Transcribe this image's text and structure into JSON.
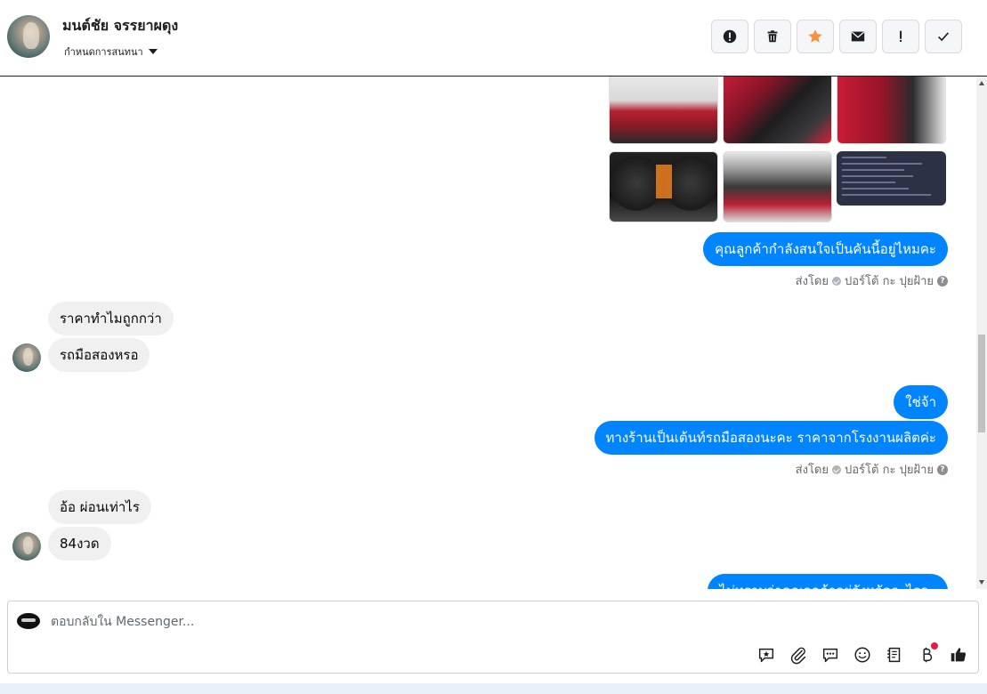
{
  "header": {
    "contact_name": "มนต์ชัย จรรยาผดุง",
    "assign_label": "กำหนดการสนทนา",
    "actions": [
      {
        "name": "spam-report",
        "icon": "alert-circle-icon"
      },
      {
        "name": "delete",
        "icon": "trash-icon"
      },
      {
        "name": "star",
        "icon": "star-icon",
        "color": "#f7923b"
      },
      {
        "name": "mark-unread",
        "icon": "envelope-icon"
      },
      {
        "name": "follow-up",
        "icon": "exclamation-icon"
      },
      {
        "name": "mark-done",
        "icon": "check-icon"
      }
    ]
  },
  "messages": {
    "out_1": "คุณลูกค้ากำลังสนใจเป็นคันนี้อยู่ไหมคะ",
    "sent_by_1": "ส่งโดย",
    "sender_1": "ปอร์โต้ กะ ปุยฝ้าย",
    "in_1": "ราคาทำไมถูกกว่า",
    "in_2": "รถมือสองหรอ",
    "out_2": "ใช่จ้า",
    "out_3": "ทางร้านเป็นเต้นท์รถมือสองนะคะ ราคาจากโรงงานผลิตค่ะ",
    "sent_by_2": "ส่งโดย",
    "sender_2": "ปอร์โต้ กะ ปุยฝ้าย",
    "in_3": "อ้อ ผ่อนเท่าไร",
    "in_4": "84งวด",
    "out_4_partial": "ไม่ทราบว่าคุณลูกค้าอยู่จังหวัดอะไรคะ"
  },
  "composer": {
    "placeholder": "ตอบกลับใน Messenger...",
    "tools": [
      "saved-reply-icon",
      "attachment-icon",
      "chat-bubble-icon",
      "emoji-icon",
      "catalog-icon",
      "baht-payment-icon",
      "thumbs-up-icon"
    ]
  },
  "colors": {
    "outgoing_bubble": "#0084ff",
    "incoming_bubble": "#f0f0f0",
    "star_active": "#f7923b",
    "notification": "#e41e3f"
  }
}
